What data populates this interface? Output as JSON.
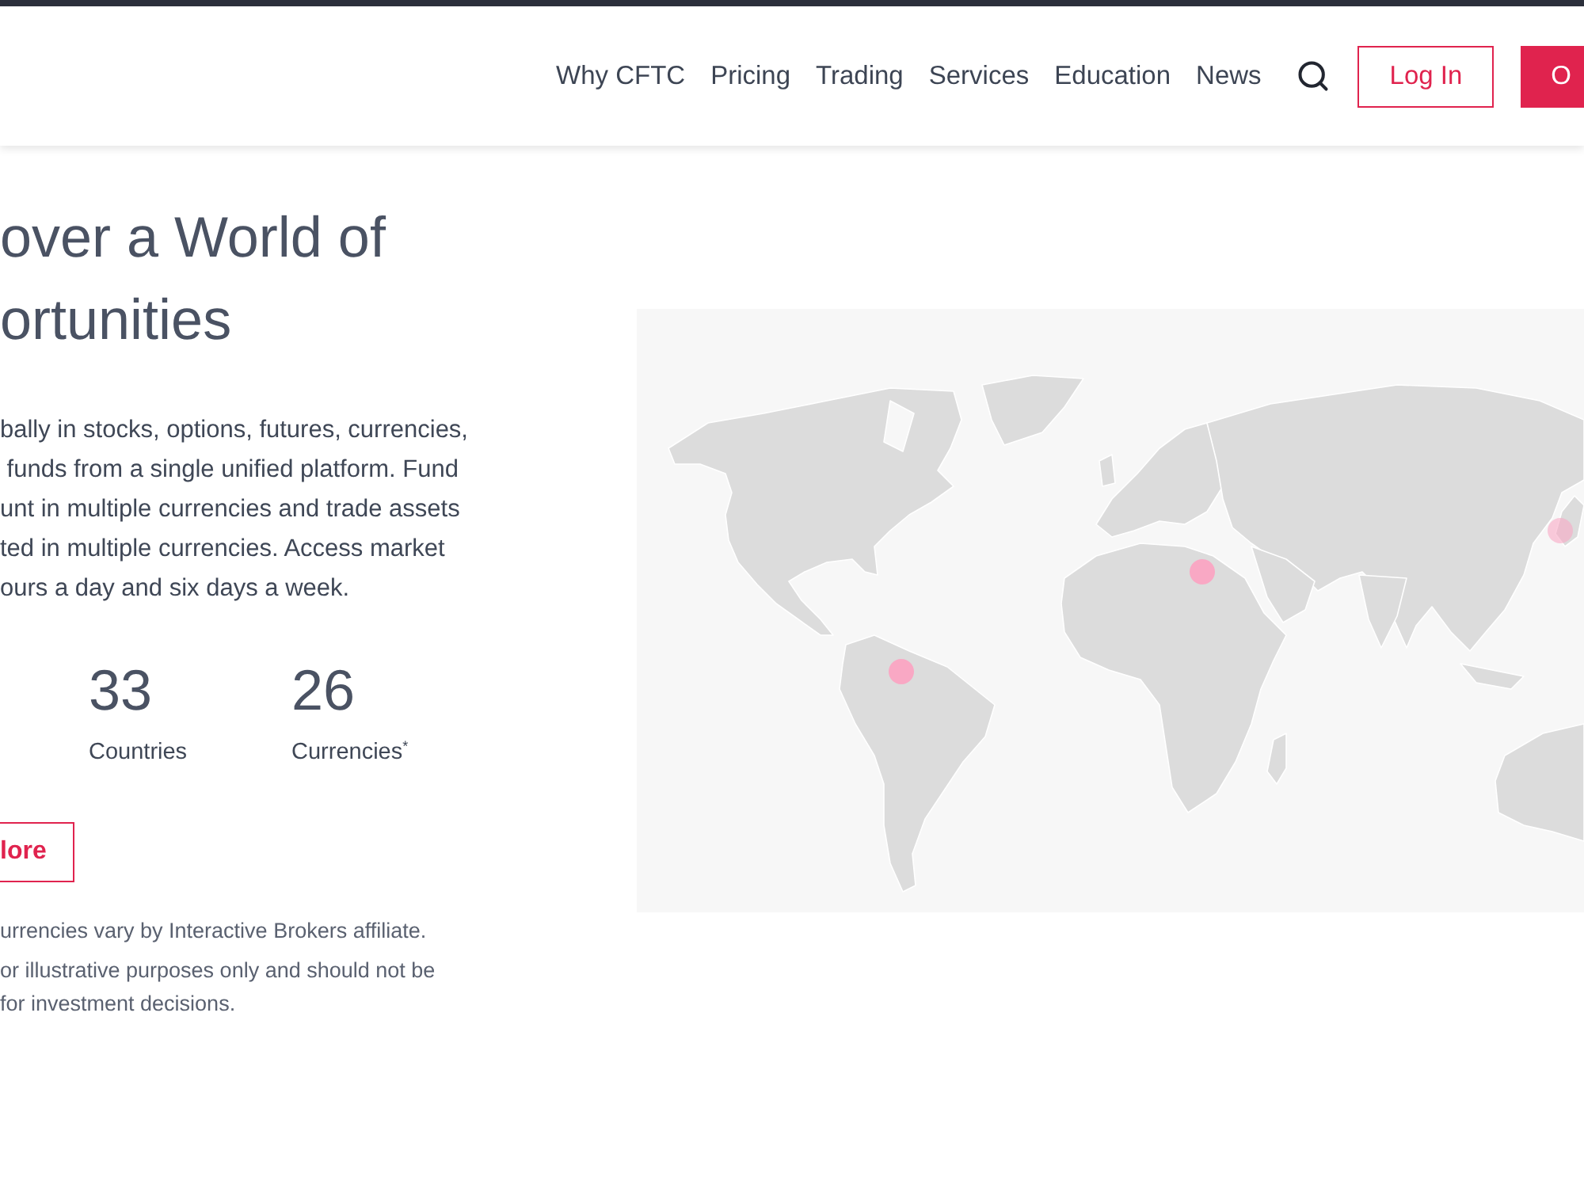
{
  "header": {
    "nav": [
      "Why CFTC",
      "Pricing",
      "Trading",
      "Services",
      "Education",
      "News"
    ],
    "login_button": "Log In",
    "cta_button": "O"
  },
  "hero": {
    "title": "over a World of\nortunities",
    "body": "bally in stocks, options, futures, currencies,\n funds from a single unified platform. Fund\nunt in multiple currencies and trade assets\nted in multiple currencies. Access market\nours a day and six days a week.",
    "stats": [
      {
        "value": "33",
        "label": "Countries"
      },
      {
        "value": "26",
        "label": "Currencies$^{*}$"
      }
    ],
    "button": "lore",
    "footnotes": [
      "urrencies vary by Interactive Brokers affiliate.",
      "or illustrative purposes only and should not be\nfor investment decisions."
    ]
  }
}
